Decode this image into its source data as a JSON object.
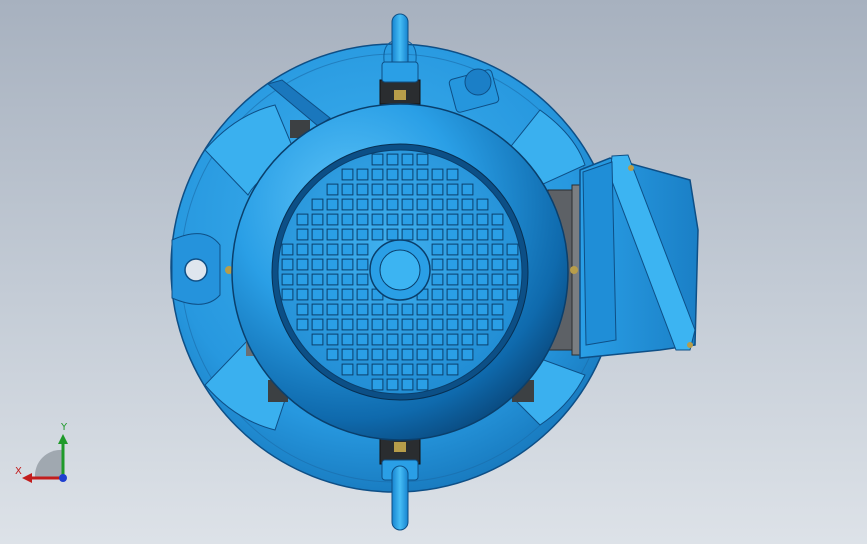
{
  "viewport": {
    "background_top": "#a7b1bf",
    "background_bottom": "#dde2e8"
  },
  "model": {
    "description_icon": "electric-motor-3d-model",
    "body_color": "#2a9fe6",
    "shadow_color": "#0d5f9c",
    "metal_color": "#6b6f73",
    "fan_grid_rows": 16
  },
  "triad": {
    "y_label": "Y",
    "x_label": "X",
    "y_color": "#1f9a2a",
    "x_color": "#c21d1d",
    "z_color": "#1e3fd0"
  }
}
